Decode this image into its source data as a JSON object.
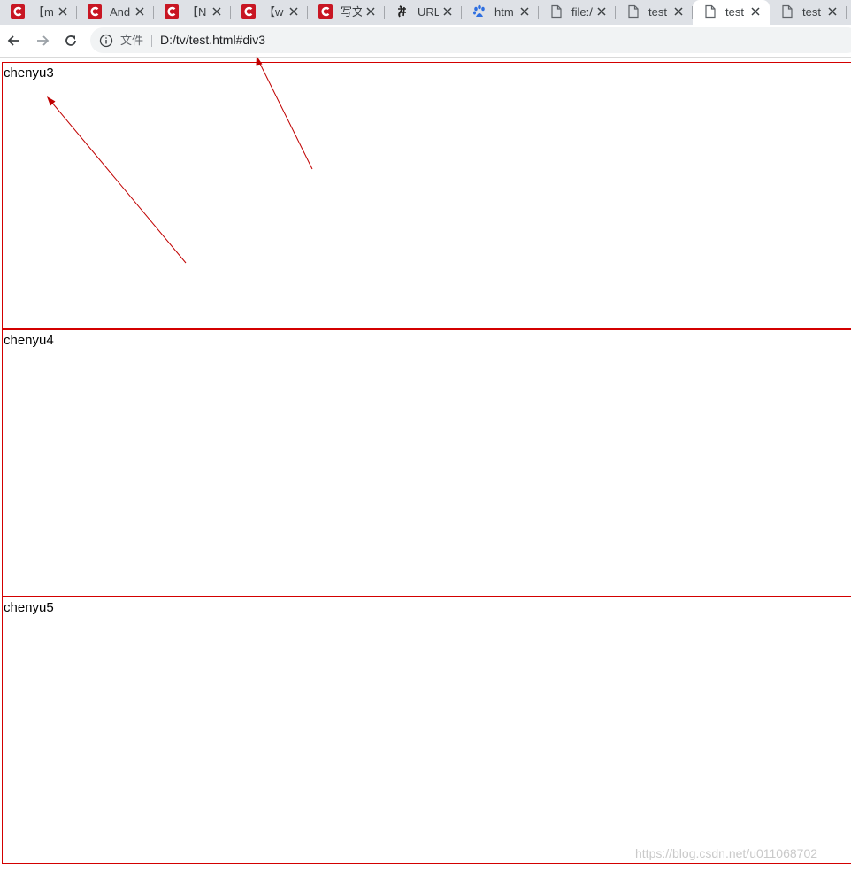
{
  "browser": {
    "tabs": [
      {
        "title": "【m",
        "favicon": "csdn-icon",
        "active": false
      },
      {
        "title": "And",
        "favicon": "csdn-icon",
        "active": false
      },
      {
        "title": "【N",
        "favicon": "csdn-icon",
        "active": false
      },
      {
        "title": "【w",
        "favicon": "csdn-icon",
        "active": false
      },
      {
        "title": "写文",
        "favicon": "csdn-icon",
        "active": false
      },
      {
        "title": "URL",
        "favicon": "jianshu-icon",
        "active": false
      },
      {
        "title": "htm",
        "favicon": "baidu-paw-icon",
        "active": false
      },
      {
        "title": "file:/",
        "favicon": "file-icon",
        "active": false
      },
      {
        "title": "test",
        "favicon": "file-icon",
        "active": false
      },
      {
        "title": "test",
        "favicon": "file-icon",
        "active": true
      },
      {
        "title": "test",
        "favicon": "file-icon",
        "active": false
      }
    ],
    "toolbar": {
      "back": "back-arrow-icon",
      "forward": "forward-arrow-icon",
      "reload": "reload-icon"
    },
    "address": {
      "security_icon": "info-icon",
      "scheme_label": "文件",
      "url": "D:/tv/test.html#div3"
    }
  },
  "page": {
    "blocks": [
      {
        "label": "chenyu3"
      },
      {
        "label": "chenyu4"
      },
      {
        "label": "chenyu5"
      }
    ],
    "watermark": "https://blog.csdn.net/u011068702"
  },
  "colors": {
    "block_border": "#d30000",
    "annotation_arrow": "#c00000",
    "csdn_red": "#c81623",
    "tabstrip_bg": "#dee1e6",
    "omnibox_bg": "#f1f3f4"
  }
}
